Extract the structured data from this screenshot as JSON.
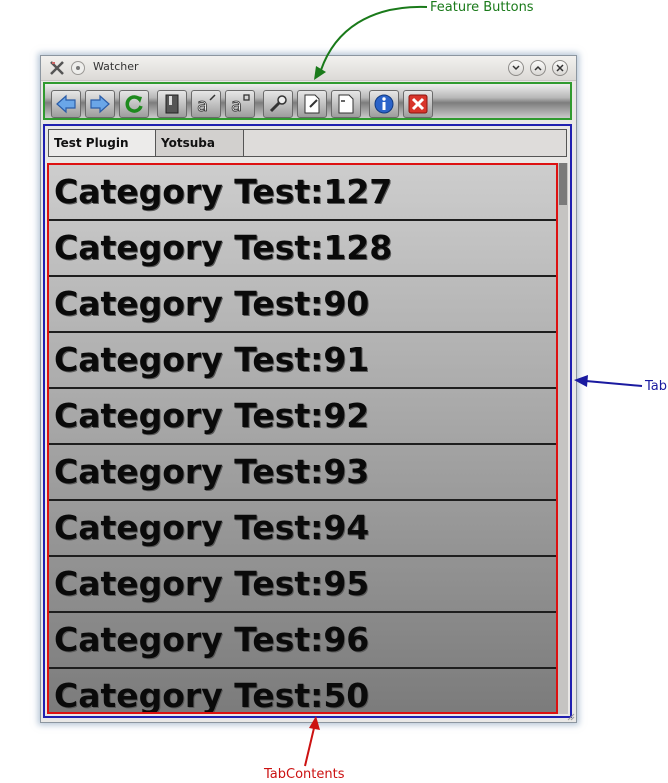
{
  "annotations": {
    "feature_buttons": "Feature Buttons",
    "tab": "Tab",
    "tab_contents": "TabContents"
  },
  "window": {
    "title": "Watcher",
    "controls": [
      "minimize-icon",
      "maximize-icon",
      "close-icon"
    ]
  },
  "toolbar": {
    "buttons": [
      {
        "name": "back",
        "icon": "arrow-left-icon"
      },
      {
        "name": "forward",
        "icon": "arrow-right-icon"
      },
      {
        "name": "refresh",
        "icon": "refresh-icon"
      },
      {
        "name": "bookmark",
        "icon": "bookmark-icon"
      },
      {
        "name": "font-decrease",
        "icon": "font-decrease-icon"
      },
      {
        "name": "font-increase",
        "icon": "font-increase-icon"
      },
      {
        "name": "settings",
        "icon": "wrench-icon"
      },
      {
        "name": "edit-page",
        "icon": "page-edit-icon"
      },
      {
        "name": "new-page",
        "icon": "page-add-icon"
      },
      {
        "name": "info",
        "icon": "info-icon"
      },
      {
        "name": "close",
        "icon": "close-red-icon"
      }
    ]
  },
  "tabs": [
    {
      "label": "Test Plugin",
      "active": true
    },
    {
      "label": "Yotsuba",
      "active": false
    }
  ],
  "tab_contents": {
    "items": [
      "Category Test:127",
      "Category Test:128",
      "Category Test:90",
      "Category Test:91",
      "Category Test:92",
      "Category Test:93",
      "Category Test:94",
      "Category Test:95",
      "Category Test:96",
      "Category Test:50"
    ]
  },
  "colors": {
    "feature_annotation": "#1a7a1a",
    "tab_annotation": "#1a1aa0",
    "tabcontents_annotation": "#cc1111"
  }
}
